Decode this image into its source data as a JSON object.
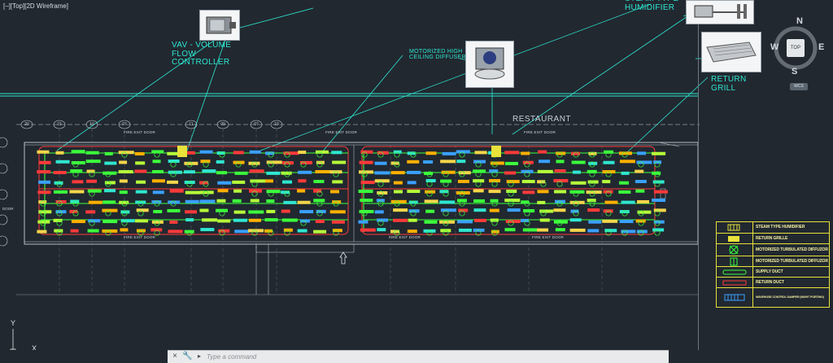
{
  "viewport_label": "[–][Top][2D Wireframe]",
  "annotations": {
    "vav": "VAV - VOLUME\nFLOW\nCONTROLLER",
    "diffuser": "MOTORIZED HIGH\nCEILING DIFFUSER",
    "humidifier": "STEAM TYPE\nHUMIDIFIER",
    "return_grill": "RETURN\nGRILL",
    "restaurant": "RESTAURANT"
  },
  "plan_labels": {
    "fire_exit": "FIRE EXIT DOOR",
    "door": "DOOR"
  },
  "grid_numbers": [
    "20",
    "15",
    "10",
    "07",
    "11",
    "09",
    "07",
    "19"
  ],
  "viewcube": {
    "north": "N",
    "south": "S",
    "east": "E",
    "west": "W",
    "top": "TOP",
    "wcs": "WCS"
  },
  "legend": {
    "items": [
      {
        "label": "STEAM TYPE HUMIDIFIER",
        "icon": "humidifier-symbol",
        "color": "#e8e23a"
      },
      {
        "label": "RETURN GRILLE",
        "icon": "return-grille-symbol",
        "color": "#e8e23a"
      },
      {
        "label": "MOTORIZED TURBULATED DIFFUZOR",
        "icon": "diffuser-symbol",
        "color": "#3cff3c"
      },
      {
        "label": "MOTORIZED TURBULATED DIFFUZOR",
        "icon": "diffuser-symbol-small",
        "color": "#3cff3c"
      },
      {
        "label": "SUPPLY DUCT",
        "icon": "supply-duct-symbol",
        "color": "#3cff3c"
      },
      {
        "label": "RETURN DUCT",
        "icon": "return-duct-symbol",
        "color": "#ff3a3a"
      },
      {
        "label": "WAVEHOSE CONTROL DAMPER (NIGHT PORTING)",
        "icon": "vav-symbol",
        "color": "#3aa0ff"
      }
    ]
  },
  "ucs": {
    "x": "X",
    "y": "Y"
  },
  "command": {
    "placeholder": "Type a command",
    "value": ""
  },
  "colors": {
    "background": "#212830",
    "annotation": "#2fe6d0",
    "supply": "#3cff3c",
    "return": "#ff3a3a",
    "legend_border": "#e8e23a"
  }
}
